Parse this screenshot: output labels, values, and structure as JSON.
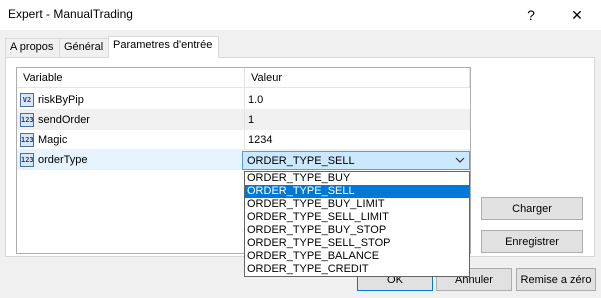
{
  "window": {
    "title": "Expert - ManualTrading",
    "help_label": "?",
    "close_label": "✕"
  },
  "tabs": [
    {
      "label": "A propos"
    },
    {
      "label": "Général"
    },
    {
      "label": "Parametres d'entrée"
    }
  ],
  "grid": {
    "headers": {
      "variable": "Variable",
      "value": "Valeur"
    },
    "rows": [
      {
        "name": "riskByPip",
        "value": "1.0",
        "type_icon": "V2"
      },
      {
        "name": "sendOrder",
        "value": "1",
        "type_icon": "123"
      },
      {
        "name": "Magic",
        "value": "1234",
        "type_icon": "123"
      },
      {
        "name": "orderType",
        "value": "ORDER_TYPE_SELL",
        "type_icon": "123"
      }
    ]
  },
  "dropdown": {
    "selected": "ORDER_TYPE_SELL",
    "options": [
      "ORDER_TYPE_BUY",
      "ORDER_TYPE_SELL",
      "ORDER_TYPE_BUY_LIMIT",
      "ORDER_TYPE_SELL_LIMIT",
      "ORDER_TYPE_BUY_STOP",
      "ORDER_TYPE_SELL_STOP",
      "ORDER_TYPE_BALANCE",
      "ORDER_TYPE_CREDIT"
    ]
  },
  "buttons": {
    "load": "Charger",
    "save": "Enregistrer",
    "ok": "OK",
    "cancel": "Annuler",
    "reset": "Remise a zéro"
  },
  "colors": {
    "selection": "#0078d7",
    "row_highlight": "#e5f3ff",
    "combo_bg": "#cce8ff"
  }
}
